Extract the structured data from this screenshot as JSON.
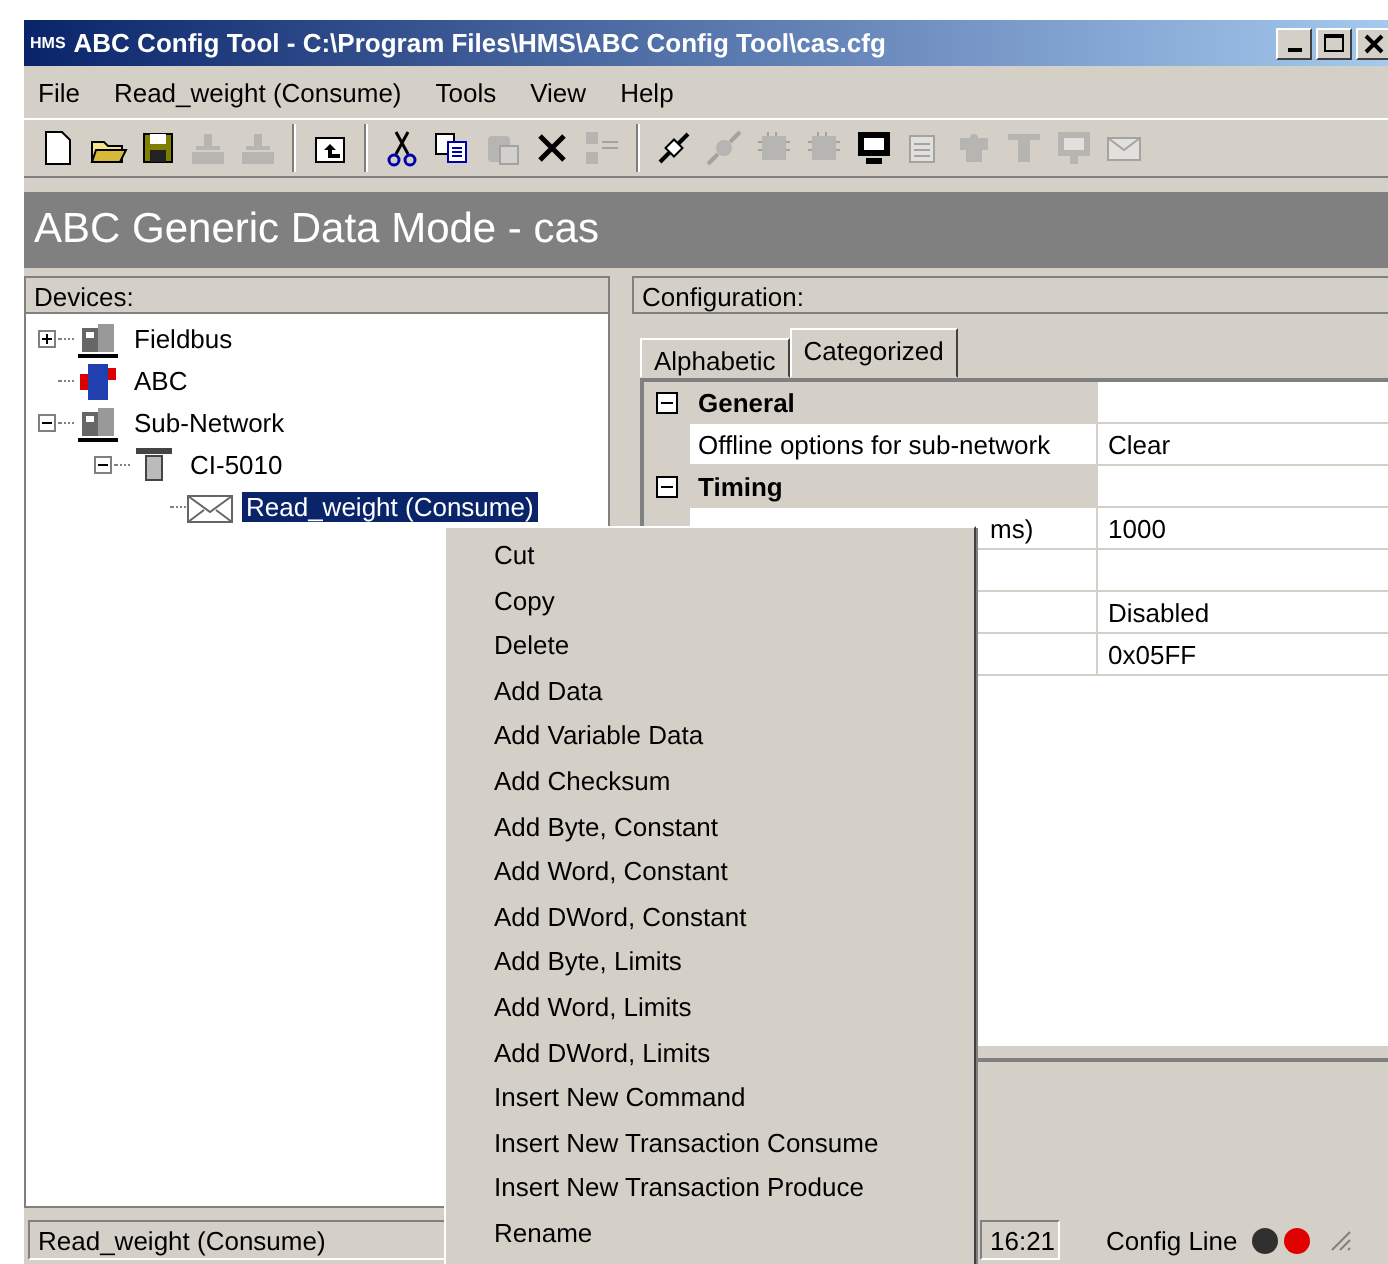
{
  "window": {
    "logo": "HMS",
    "title": "ABC Config Tool - C:\\Program Files\\HMS\\ABC Config Tool\\cas.cfg"
  },
  "menu_bar": [
    "File",
    "Read_weight (Consume)",
    "Tools",
    "View",
    "Help"
  ],
  "toolbar": [
    {
      "kind": "new",
      "disabled": false
    },
    {
      "kind": "open",
      "disabled": false
    },
    {
      "kind": "save",
      "disabled": false
    },
    {
      "kind": "upload",
      "disabled": true
    },
    {
      "kind": "download",
      "disabled": true
    },
    {
      "kind": "separator"
    },
    {
      "kind": "folder-up",
      "disabled": false
    },
    {
      "kind": "separator"
    },
    {
      "kind": "cut",
      "disabled": false
    },
    {
      "kind": "copy",
      "disabled": false
    },
    {
      "kind": "paste",
      "disabled": true
    },
    {
      "kind": "delete",
      "disabled": false
    },
    {
      "kind": "compare",
      "disabled": true
    },
    {
      "kind": "separator"
    },
    {
      "kind": "connect",
      "disabled": false
    },
    {
      "kind": "disconnect",
      "disabled": true
    },
    {
      "kind": "chip",
      "disabled": true
    },
    {
      "kind": "chip",
      "disabled": true
    },
    {
      "kind": "monitor",
      "disabled": false
    },
    {
      "kind": "properties",
      "disabled": true
    },
    {
      "kind": "puzzle",
      "disabled": true
    },
    {
      "kind": "node",
      "disabled": true
    },
    {
      "kind": "screen",
      "disabled": true
    },
    {
      "kind": "mail",
      "disabled": true
    }
  ],
  "mode_header": "ABC Generic Data Mode - cas",
  "devices": {
    "title": "Devices:",
    "tree": [
      {
        "label": "Fieldbus",
        "kind": "fieldbus",
        "expanded": false,
        "selected": false
      },
      {
        "label": "ABC",
        "kind": "abc",
        "selected": false
      },
      {
        "label": "Sub-Network",
        "kind": "subnet",
        "expanded": true,
        "selected": false,
        "children": [
          {
            "label": "CI-5010",
            "kind": "node",
            "expanded": true,
            "selected": false,
            "children": [
              {
                "label": "Read_weight (Consume)",
                "kind": "mail",
                "selected": true
              }
            ]
          }
        ]
      }
    ]
  },
  "configuration": {
    "title": "Configuration:",
    "tabs": [
      {
        "label": "Alphabetic",
        "selected": false
      },
      {
        "label": "Categorized",
        "selected": true
      }
    ],
    "rows": [
      {
        "kind": "category",
        "name": "General",
        "expanded": true
      },
      {
        "kind": "property",
        "name": "Offline options for sub-network",
        "value": "Clear"
      },
      {
        "kind": "category",
        "name": "Timing",
        "expanded": true
      },
      {
        "kind": "partial",
        "name": "ms)",
        "value": "1000"
      },
      {
        "kind": "property"
      },
      {
        "kind": "property",
        "value": "Disabled"
      },
      {
        "kind": "property",
        "value": "0x05FF"
      }
    ]
  },
  "context_menu": [
    "Cut",
    "Copy",
    "Delete",
    "Add Data",
    "Add Variable Data",
    "Add Checksum",
    "Add Byte, Constant",
    "Add Word, Constant",
    "Add DWord, Constant",
    "Add Byte, Limits",
    "Add Word, Limits",
    "Add DWord, Limits",
    "Insert New Command",
    "Insert New Transaction Consume",
    "Insert New Transaction Produce",
    "Rename"
  ],
  "status_bar": {
    "selection": "Read_weight (Consume)",
    "time": "16:21",
    "line": "Config Line",
    "leds": [
      {
        "color": "#303030"
      },
      {
        "color": "#e00000"
      }
    ]
  }
}
